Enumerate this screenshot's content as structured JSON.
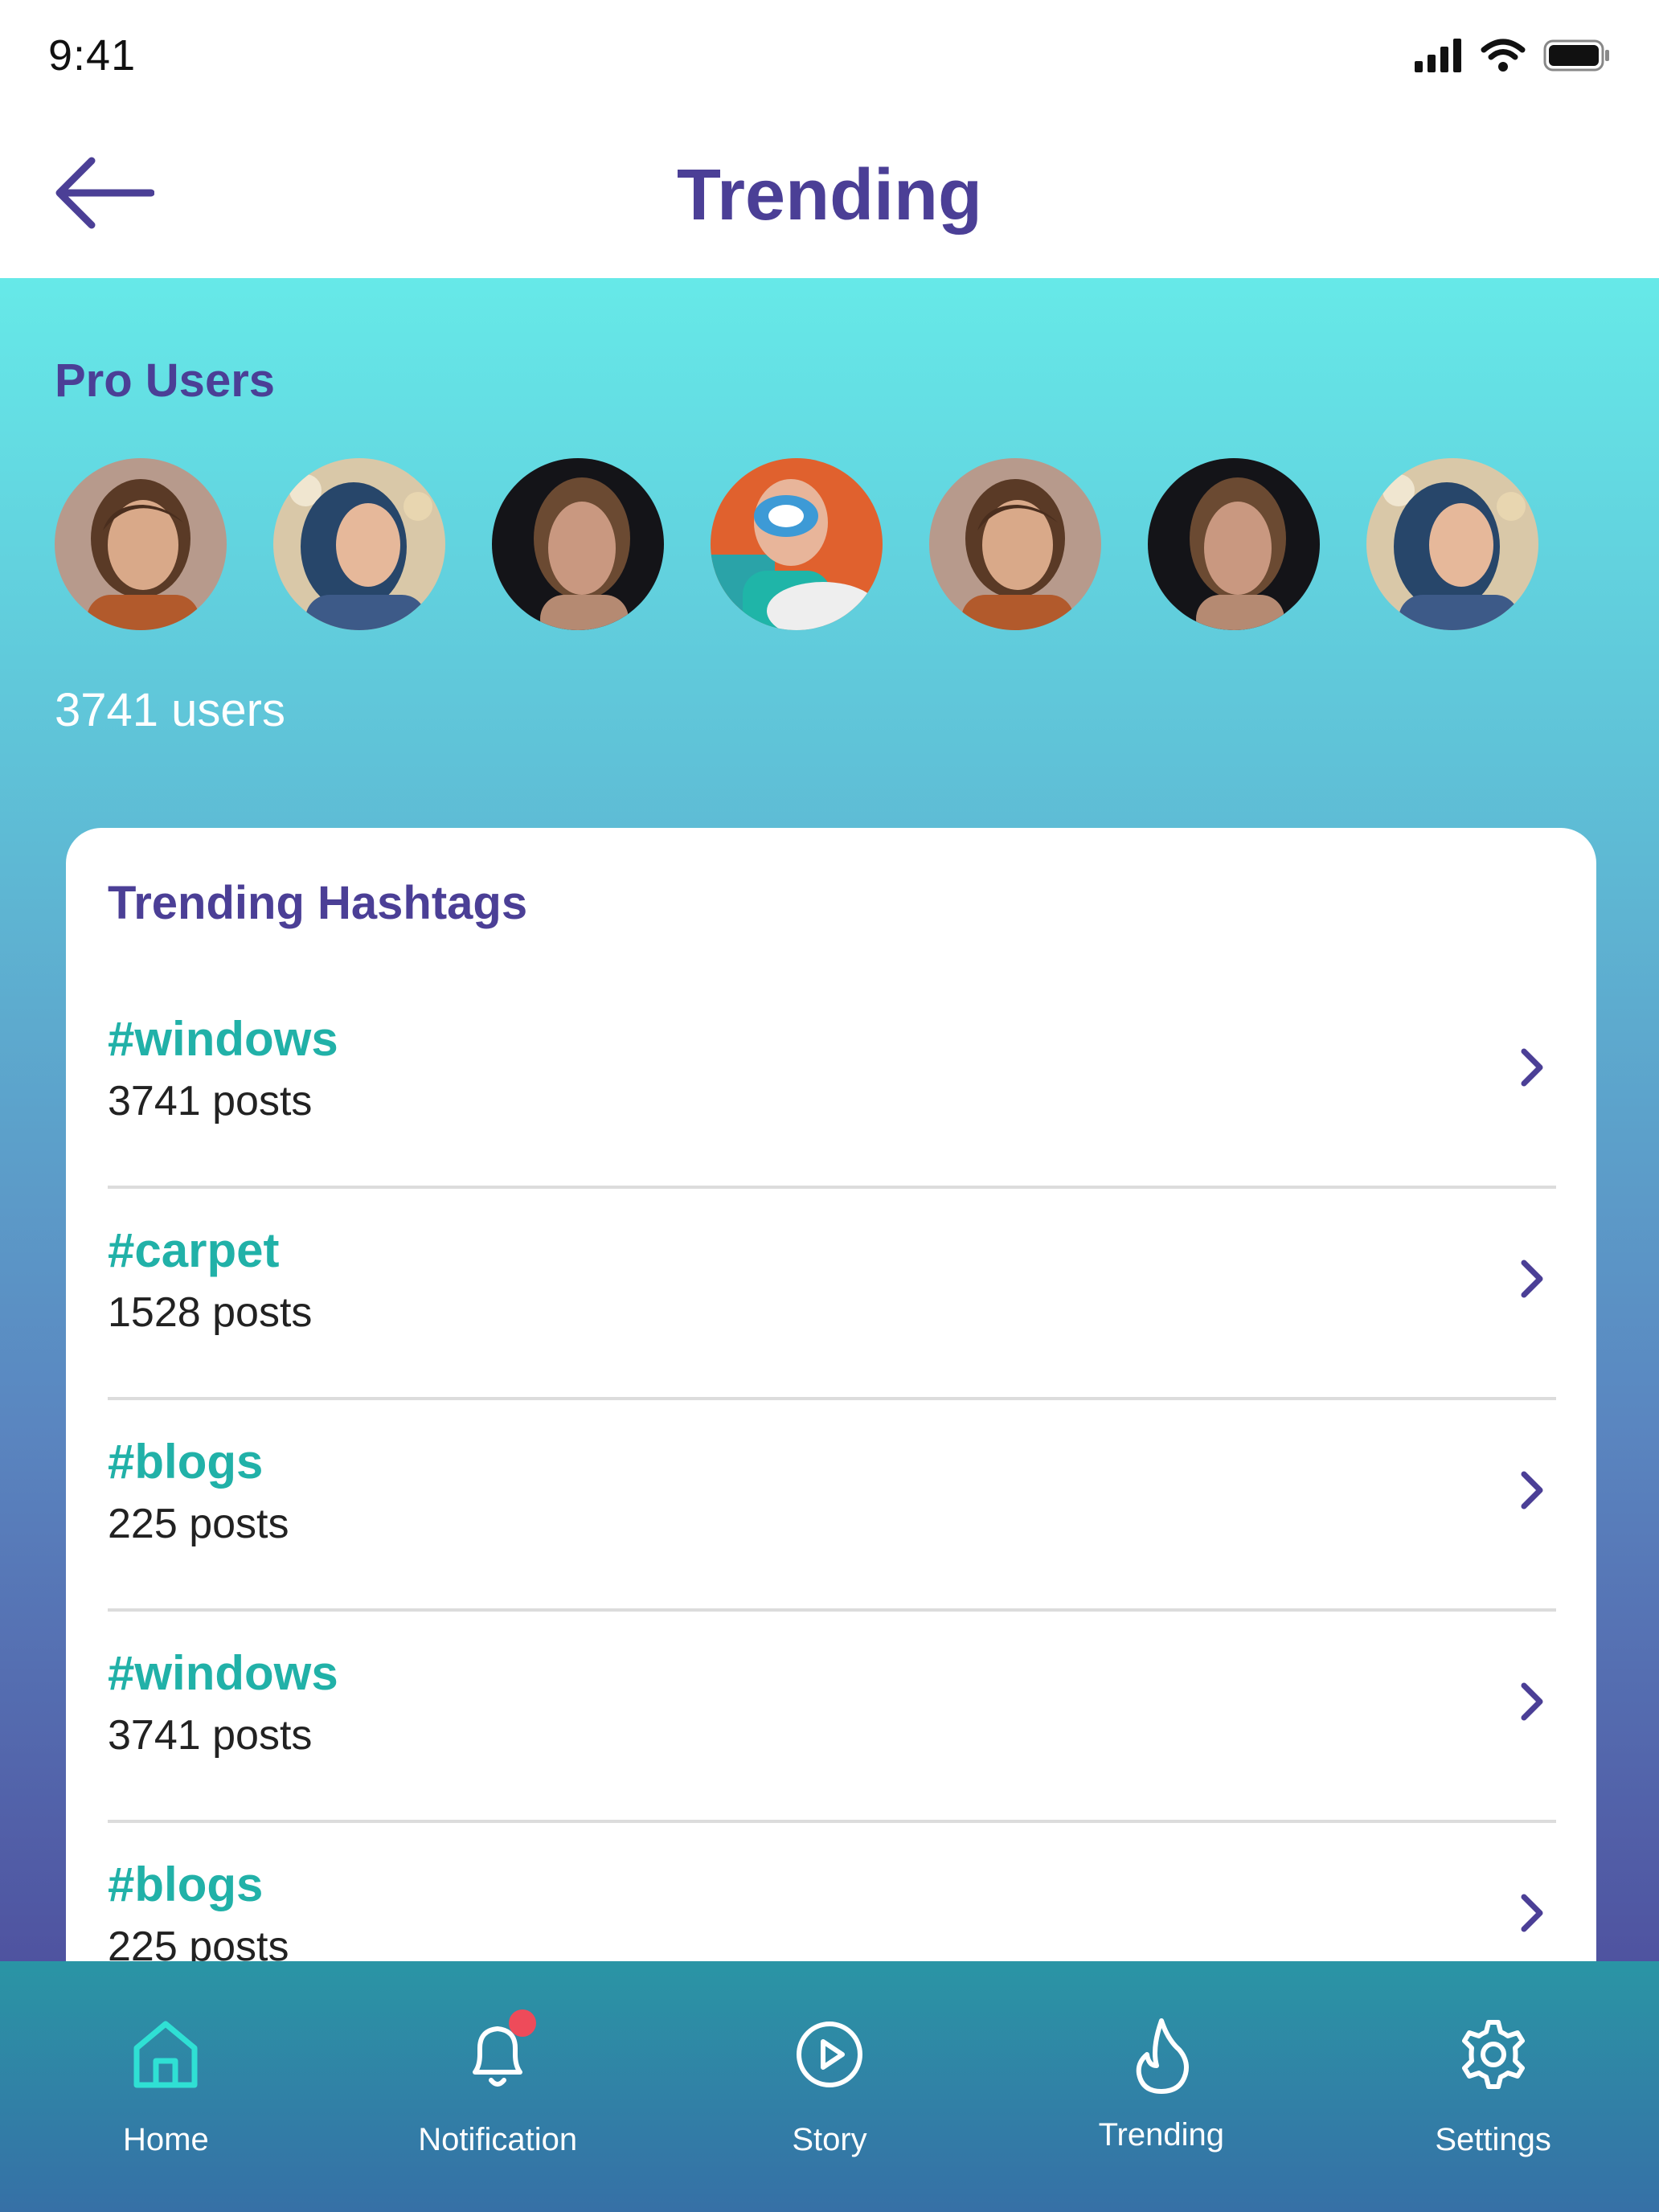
{
  "status_bar": {
    "time": "9:41"
  },
  "header": {
    "title": "Trending"
  },
  "pro_users": {
    "title": "Pro Users",
    "count_label": "3741 users",
    "avatars": [
      {
        "name": "user-avatar-1"
      },
      {
        "name": "user-avatar-2"
      },
      {
        "name": "user-avatar-3"
      },
      {
        "name": "user-avatar-4"
      },
      {
        "name": "user-avatar-5"
      },
      {
        "name": "user-avatar-6"
      },
      {
        "name": "user-avatar-7"
      }
    ]
  },
  "hashtags": {
    "title": "Trending Hashtags",
    "items": [
      {
        "tag": "#windows",
        "posts": "3741 posts"
      },
      {
        "tag": "#carpet",
        "posts": "1528 posts"
      },
      {
        "tag": "#blogs",
        "posts": "225 posts"
      },
      {
        "tag": "#windows",
        "posts": "3741 posts"
      },
      {
        "tag": "#blogs",
        "posts": "225 posts"
      }
    ]
  },
  "bottom_nav": {
    "items": [
      {
        "label": "Home",
        "icon": "home-icon",
        "active": true
      },
      {
        "label": "Notification",
        "icon": "bell-icon",
        "badge": true
      },
      {
        "label": "Story",
        "icon": "play-circle-icon"
      },
      {
        "label": "Trending",
        "icon": "flame-icon"
      },
      {
        "label": "Settings",
        "icon": "gear-icon"
      }
    ]
  },
  "colors": {
    "title": "#4b3f96",
    "hashtag": "#21b1a8",
    "gradient_top": "#66e9e8",
    "gradient_bottom": "#4f53a0",
    "nav_active": "#2fe0d4",
    "badge": "#ee4b5a"
  }
}
